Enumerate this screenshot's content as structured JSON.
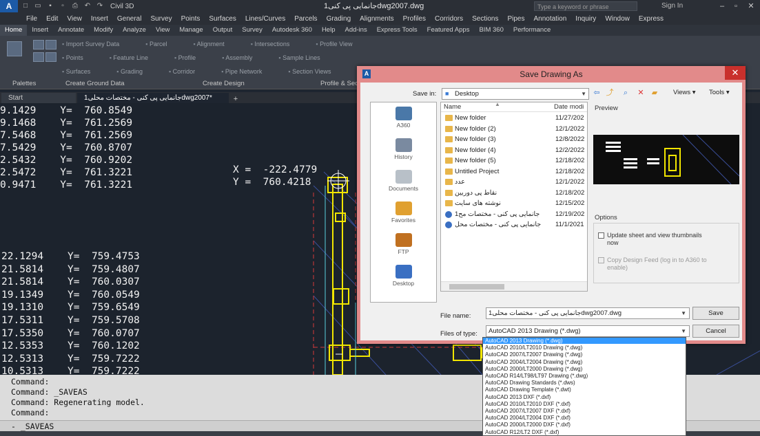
{
  "titlebar": {
    "workspace": "Civil 3D",
    "document_title": "جانمایی پی کنی1dwg2007.dwg",
    "search_placeholder": "Type a keyword or phrase",
    "signin": "Sign In"
  },
  "menu": [
    "File",
    "Edit",
    "View",
    "Insert",
    "General",
    "Survey",
    "Points",
    "Surfaces",
    "Lines/Curves",
    "Parcels",
    "Grading",
    "Alignments",
    "Profiles",
    "Corridors",
    "Sections",
    "Pipes",
    "Annotation",
    "Inquiry",
    "Window",
    "Express"
  ],
  "ribbon_tabs": [
    "Home",
    "Insert",
    "Annotate",
    "Modify",
    "Analyze",
    "View",
    "Manage",
    "Output",
    "Survey",
    "Autodesk 360",
    "Help",
    "Add-ins",
    "Express Tools",
    "Featured Apps",
    "BIM 360",
    "Performance"
  ],
  "ribbon": {
    "row1": [
      "Import Survey Data",
      "Parcel",
      "Alignment",
      "Intersections",
      "Profile View"
    ],
    "row2": [
      "Points",
      "Feature Line",
      "Profile",
      "Assembly",
      "Sample Lines"
    ],
    "row3": [
      "Surfaces",
      "Grading",
      "Corridor",
      "Pipe Network",
      "Section Views"
    ],
    "panels": [
      "Palettes",
      "Create Ground Data",
      "Create Design",
      "Profile & Section Views"
    ]
  },
  "doc_tabs": {
    "start": "Start",
    "active": "جانمایی پی کنی - مختصات محلی1dwg2007*"
  },
  "coordinates_top": [
    "9.1429    Y=  760.8549",
    "9.1468    Y=  761.2569",
    "7.5468    Y=  761.2569",
    "7.5429    Y=  760.8707",
    "2.5432    Y=  760.9202",
    "2.5472    Y=  761.3221",
    "0.9471    Y=  761.3221"
  ],
  "cursor_coords": {
    "x": "X =  -222.4779",
    "y": "Y =  760.4218"
  },
  "coordinates_bottom": [
    "22.1294    Y=  759.4753",
    "21.5814    Y=  759.4807",
    "21.5814    Y=  760.0307",
    "19.1349    Y=  760.0549",
    "19.1310    Y=  759.6549",
    "17.5311    Y=  759.5708",
    "17.5350    Y=  760.0707",
    "12.5353    Y=  760.1202",
    "12.5313    Y=  759.7222",
    "10.5313    Y=  759.7222"
  ],
  "command_history": [
    "Command:",
    "Command: _SAVEAS",
    "Command: Regenerating model.",
    "Command:"
  ],
  "command_input": "- _SAVEAS",
  "dialog": {
    "title": "Save Drawing As",
    "save_in_label": "Save in:",
    "save_in_value": "Desktop",
    "views": "Views",
    "tools": "Tools",
    "places": [
      "A360",
      "History",
      "Documents",
      "Favorites",
      "FTP",
      "Desktop"
    ],
    "columns": {
      "name": "Name",
      "date": "Date modi"
    },
    "files": [
      {
        "name": "New folder",
        "date": "11/27/202"
      },
      {
        "name": "New folder (2)",
        "date": "12/1/2022"
      },
      {
        "name": "New folder (3)",
        "date": "12/8/2022"
      },
      {
        "name": "New folder (4)",
        "date": "12/2/2022"
      },
      {
        "name": "New folder (5)",
        "date": "12/18/202"
      },
      {
        "name": "Untitled Project",
        "date": "12/18/202"
      },
      {
        "name": "عدد",
        "date": "12/1/2022"
      },
      {
        "name": "نقاط پی دوربین",
        "date": "12/18/202"
      },
      {
        "name": "نوشته های سایت",
        "date": "12/15/202"
      },
      {
        "name": "1جانمایی پی کنی - مختصات مح",
        "date": "12/19/202"
      },
      {
        "name": "جانمایی پی کنی - مختصات محل",
        "date": "11/1/2021"
      }
    ],
    "preview_label": "Preview",
    "options_label": "Options",
    "options": [
      {
        "label": "Update sheet and view thumbnails now",
        "enabled": true
      },
      {
        "label": "Copy Design Feed (log in to A360 to enable)",
        "enabled": false
      }
    ],
    "file_name_label": "File name:",
    "file_name_value": "جانمایی پی کنی - مختصات محلی1dwg2007.dwg",
    "file_type_label": "Files of type:",
    "file_type_value": "AutoCAD 2013 Drawing (*.dwg)",
    "save_button": "Save",
    "cancel_button": "Cancel"
  },
  "file_type_options": [
    "AutoCAD 2013 Drawing (*.dwg)",
    "AutoCAD 2010/LT2010 Drawing (*.dwg)",
    "AutoCAD 2007/LT2007 Drawing (*.dwg)",
    "AutoCAD 2004/LT2004 Drawing (*.dwg)",
    "AutoCAD 2000/LT2000 Drawing (*.dwg)",
    "AutoCAD R14/LT98/LT97 Drawing (*.dwg)",
    "AutoCAD Drawing Standards (*.dws)",
    "AutoCAD Drawing Template (*.dwt)",
    "AutoCAD 2013 DXF (*.dxf)",
    "AutoCAD 2010/LT2010 DXF (*.dxf)",
    "AutoCAD 2007/LT2007 DXF (*.dxf)",
    "AutoCAD 2004/LT2004 DXF (*.dxf)",
    "AutoCAD 2000/LT2000 DXF (*.dxf)",
    "AutoCAD R12/LT2 DXF (*.dxf)"
  ],
  "colors": {
    "dialog_border": "#e28a8a",
    "selection": "#3399ff",
    "footing": "#f2e600",
    "canvas": "#1c232d"
  }
}
